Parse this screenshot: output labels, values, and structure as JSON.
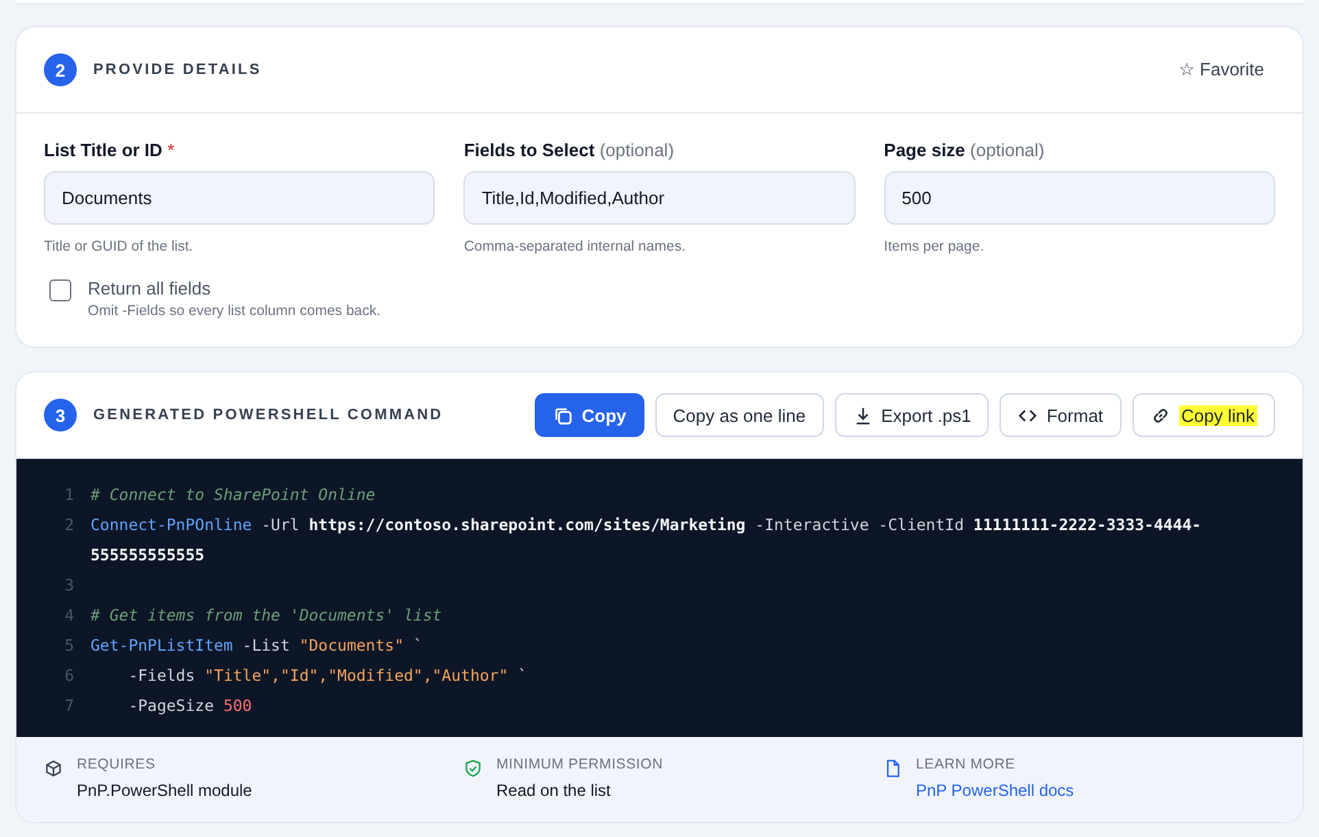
{
  "details": {
    "step": "2",
    "title": "PROVIDE DETAILS",
    "favorite": "☆ Favorite",
    "fields": [
      {
        "label": "List Title or ID",
        "required": true,
        "value": "Documents",
        "help": "Title or GUID of the list."
      },
      {
        "label": "Fields to Select",
        "required": false,
        "optional": "(optional)",
        "value": "Title,Id,Modified,Author",
        "help": "Comma-separated internal names."
      },
      {
        "label": "Page size",
        "required": false,
        "optional": "(optional)",
        "value": "500",
        "help": "Items per page."
      }
    ],
    "required_mark": "*",
    "checkbox": {
      "label": "Return all fields",
      "hint": "Omit -Fields so every list column comes back.",
      "checked": false
    }
  },
  "command": {
    "step": "3",
    "title": "GENERATED POWERSHELL COMMAND",
    "buttons": [
      {
        "label": "Copy",
        "kind": "copy",
        "primary": true,
        "highlighted": false
      },
      {
        "label": "Copy as one line",
        "kind": "none",
        "primary": false,
        "highlighted": false
      },
      {
        "label": "Export .ps1",
        "kind": "download",
        "primary": false,
        "highlighted": false
      },
      {
        "label": "Format",
        "kind": "code",
        "primary": false,
        "highlighted": false
      },
      {
        "label": "Copy link",
        "kind": "link",
        "primary": false,
        "highlighted": true
      }
    ],
    "lines": [
      {
        "number": "1",
        "tokens": [
          {
            "kind": "comment",
            "text": "# Connect to SharePoint Online"
          }
        ]
      },
      {
        "number": "2",
        "tokens": [
          {
            "kind": "cmdlet",
            "text": "Connect-PnPOnline"
          },
          {
            "kind": "param",
            "text": " -Url "
          },
          {
            "kind": "value",
            "text": "https://contoso.sharepoint.com/sites/Marketing"
          },
          {
            "kind": "param",
            "text": " -Interactive -ClientId "
          },
          {
            "kind": "value",
            "text": "11111111-2222-3333-4444-555555555555"
          }
        ]
      },
      {
        "number": "3"
      },
      {
        "number": "4",
        "tokens": [
          {
            "kind": "comment",
            "text": "# Get items from the 'Documents' list"
          }
        ]
      },
      {
        "number": "5",
        "tokens": [
          {
            "kind": "cmdlet",
            "text": "Get-PnPListItem"
          },
          {
            "kind": "param",
            "text": " -List "
          },
          {
            "kind": "string",
            "text": "\"Documents\""
          },
          {
            "kind": "param",
            "text": " `"
          }
        ]
      },
      {
        "number": "6",
        "tokens": [
          {
            "kind": "param",
            "text": "    -Fields "
          },
          {
            "kind": "string",
            "text": "\"Title\",\"Id\",\"Modified\",\"Author\""
          },
          {
            "kind": "param",
            "text": " `"
          }
        ]
      },
      {
        "number": "7",
        "tokens": [
          {
            "kind": "param",
            "text": "    -PageSize "
          },
          {
            "kind": "number",
            "text": "500"
          }
        ]
      }
    ],
    "footer": [
      {
        "kind": "module",
        "label": "REQUIRES",
        "value": "PnP.PowerShell module",
        "link": false
      },
      {
        "kind": "shield",
        "label": "MINIMUM PERMISSION",
        "value": "Read on the list",
        "link": false
      },
      {
        "kind": "doc",
        "label": "LEARN MORE",
        "value": "PnP PowerShell docs",
        "link": true
      }
    ]
  }
}
